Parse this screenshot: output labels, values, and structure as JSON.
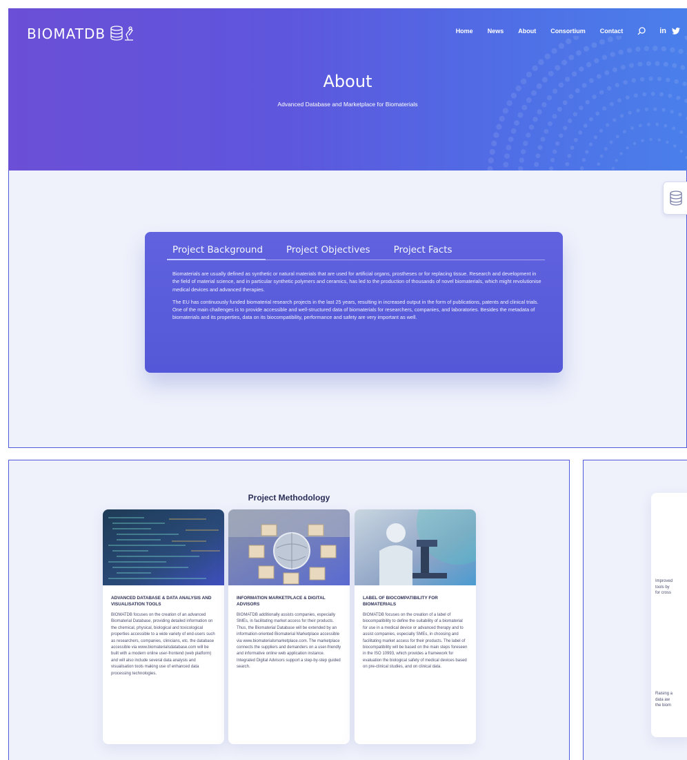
{
  "brand": {
    "name": "BIOMATDB"
  },
  "nav": {
    "items": [
      "Home",
      "News",
      "About",
      "Consortium",
      "Contact"
    ],
    "social": {
      "linkedin": "in",
      "twitter": "🐦"
    }
  },
  "hero": {
    "title": "About",
    "subtitle": "Advanced Database and Marketplace for Biomaterials"
  },
  "project_tabs": {
    "tabs": [
      {
        "label": "Project Background",
        "active": true
      },
      {
        "label": "Project Objectives",
        "active": false
      },
      {
        "label": "Project Facts",
        "active": false
      }
    ],
    "paragraphs": [
      "Biomaterials are usually defined as synthetic or natural materials that are used for artificial organs, prostheses or for replacing tissue. Research and development in the field of material science, and in particular synthetic polymers and ceramics, has led to the production of thousands of novel biomaterials, which might revolutionise medical devices and advanced therapies.",
      "The EU has continuously funded biomaterial research projects in the last 25 years, resulting in increased output in the form of publications, patents and clinical trials. One of the main challenges is to provide accessible and well-structured data of biomaterials for researchers, companies, and laboratories. Besides the metadata of biomaterials and its properties, data on its biocompatibility, performance and safety are very important as well."
    ]
  },
  "methodology": {
    "title": "Project Methodology",
    "cards": [
      {
        "title": "ADVANCED DATABASE & DATA ANALYSIS AND VISUALISATION TOOLS",
        "text": "BIOMATDB focuses on the creation of an advanced Biomaterial Database, providing detailed information on the chemical, physical, biological and toxicological properties accessible to a wide variety of end-users such as researchers, companies, clinicians, etc. the database accessible via www.biomaterialsdatabase.com will be built with a modern online user-frontend (web platform) and will also include several data analysis and visualisation tools making use of enhanced data processing technologies."
      },
      {
        "title": "INFORMATION MARKETPLACE & DIGITAL ADVISORS",
        "text": "BIOMATDB additionally assists companies, especially SMEs, in facilitating market access for their products. Thus, the Biomaterial Database will be extended by an information-oriented Biomaterial Marketplace accessible via www.biomaterialsmarketplace.com. The marketplace connects the suppliers and demanders on a user-friendly and informative online web application instance. Integrated Digital Advisors support a step-by-step guided search."
      },
      {
        "title": "LABEL OF BIOCOMPATIBILITY FOR BIOMATERIALS",
        "text": "BIOMATDB focuses on the creation of a label of biocompatibility to define the suitability of a biomaterial for use in a medical device or advanced therapy and to assist companies, especially SMEs, in choosing and facilitating market access for their products. The label of biocompatibility will be based on the main steps foreseen in the ISO 10993, which provides a framework for evaluation the biological safety of medical devices based on pre-clinical studies, and on clinical data."
      }
    ]
  },
  "partial_section": {
    "lines_top": [
      "Improved",
      "tools by",
      "for cross"
    ],
    "lines_bottom": [
      "Raising a",
      "data aw",
      "the biom"
    ]
  },
  "colors": {
    "accent": "#5458d8",
    "hero_start": "#6b4fd6",
    "hero_end": "#4a7fea",
    "panel_bg": "#eff2fb"
  }
}
